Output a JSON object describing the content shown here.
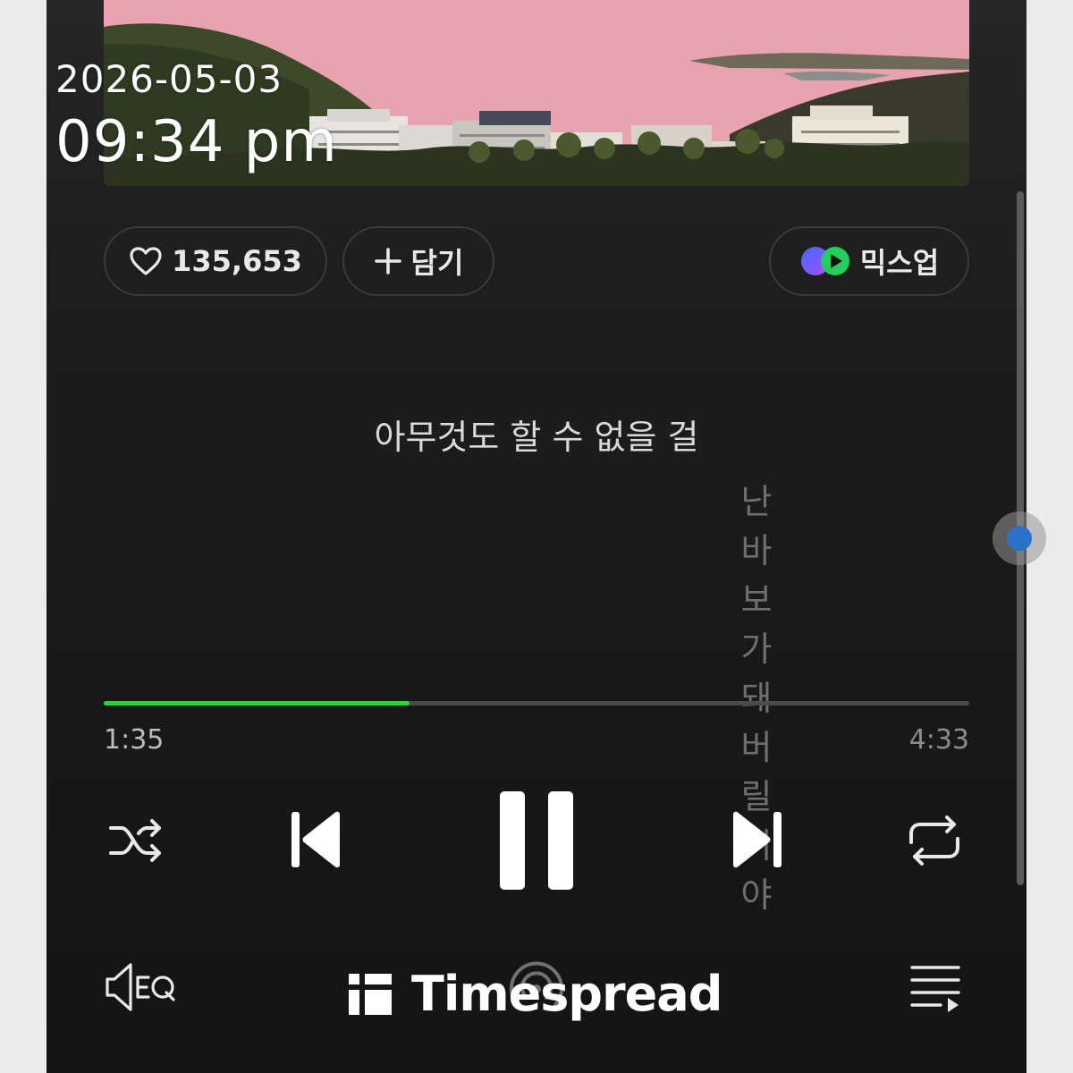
{
  "overlay": {
    "date": "2026-05-03",
    "time": "09:34 pm"
  },
  "actions": {
    "like_count": "135,653",
    "add_label": "담기",
    "mixup_label": "믹스업"
  },
  "lyrics": {
    "current": "아무것도 할 수 없을 걸",
    "next": "난 바보가 돼버릴거야"
  },
  "playback": {
    "elapsed": "1:35",
    "total": "4:33",
    "progress_fraction": 0.353,
    "accent_color": "#22d833"
  },
  "controls": {
    "shuffle_icon": "shuffle-icon",
    "prev_icon": "skip-previous-icon",
    "pause_icon": "pause-icon",
    "next_icon": "skip-next-icon",
    "repeat_icon": "repeat-icon",
    "eq_icon": "equalizer-icon",
    "cast_icon": "cast-icon",
    "queue_icon": "playlist-icon"
  },
  "watermark": {
    "text": "Timespread"
  }
}
